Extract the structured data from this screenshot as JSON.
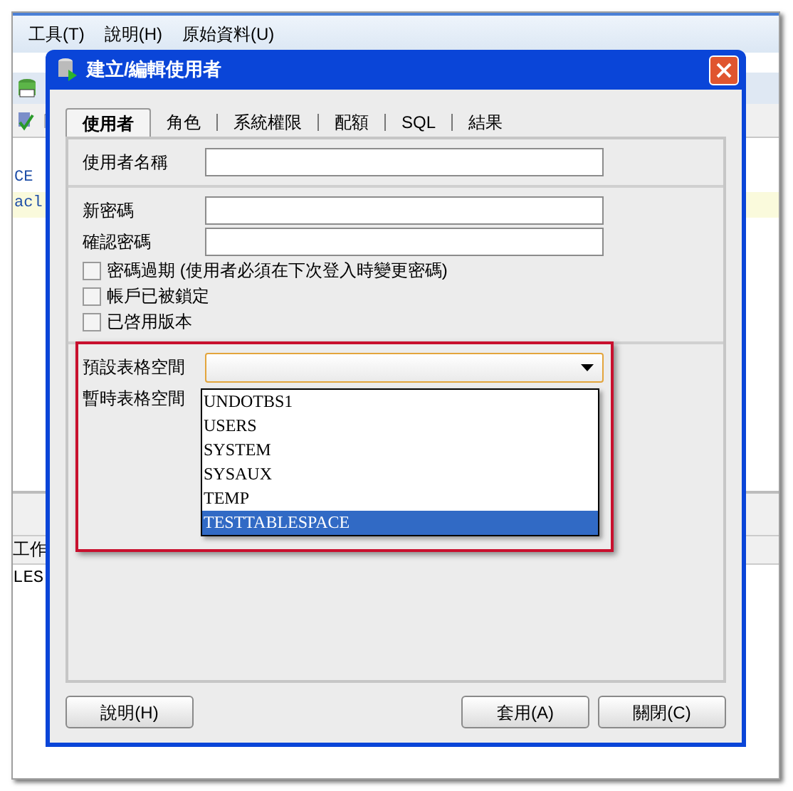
{
  "menu": [
    "工具(T)",
    "說明(H)",
    "原始資料(U)"
  ],
  "background": {
    "code_lines": [
      "CE",
      "acl"
    ],
    "panel_label": "工作",
    "panel_text": "LES"
  },
  "dialog": {
    "title": "建立/編輯使用者",
    "tabs": [
      {
        "label": "使用者",
        "selected": true
      },
      {
        "label": "角色",
        "selected": false
      },
      {
        "label": "系統權限",
        "selected": false
      },
      {
        "label": "配額",
        "selected": false
      },
      {
        "label": "SQL",
        "selected": false
      },
      {
        "label": "結果",
        "selected": false
      }
    ],
    "sections": [
      [
        {
          "kind": "text",
          "label": "使用者名稱"
        }
      ],
      [
        {
          "kind": "password",
          "label": "新密碼"
        },
        {
          "kind": "password",
          "label": "確認密碼"
        },
        {
          "kind": "checkbox",
          "label": "密碼過期 (使用者必須在下次登入時變更密碼)",
          "checked": false
        },
        {
          "kind": "checkbox",
          "label": "帳戶已被鎖定",
          "checked": false
        },
        {
          "kind": "checkbox",
          "label": "已啓用版本",
          "checked": false
        }
      ],
      [
        {
          "kind": "combo",
          "label": "預設表格空間"
        },
        {
          "kind": "label",
          "label": "暫時表格空間"
        }
      ]
    ],
    "dropdown": [
      {
        "label": "UNDOTBS1",
        "selected": false
      },
      {
        "label": "USERS",
        "selected": false
      },
      {
        "label": "SYSTEM",
        "selected": false
      },
      {
        "label": "SYSAUX",
        "selected": false
      },
      {
        "label": "TEMP",
        "selected": false
      },
      {
        "label": "TESTTABLESPACE",
        "selected": true
      }
    ],
    "buttons_left": [
      "說明(H)"
    ],
    "buttons_right": [
      "套用(A)",
      "關閉(C)"
    ]
  }
}
